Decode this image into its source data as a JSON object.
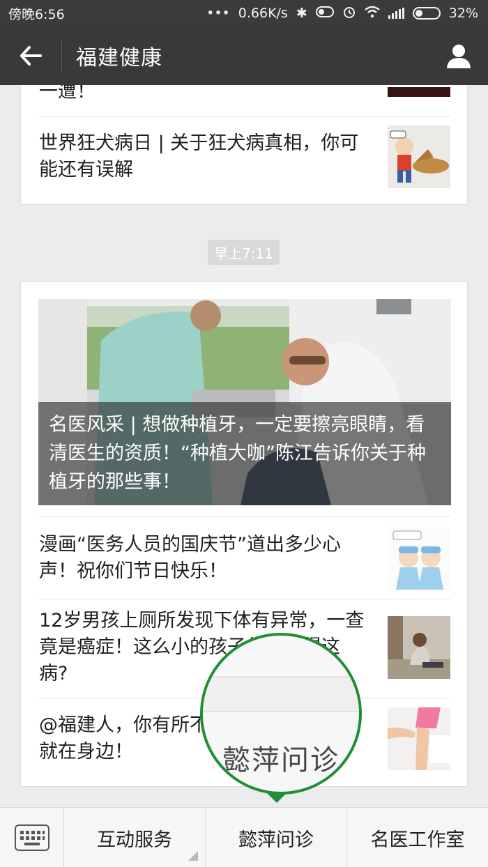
{
  "status_bar": {
    "time": "傍晚6:56",
    "network_speed": "0.66K/s",
    "battery": "32%"
  },
  "nav": {
    "title": "福建健康"
  },
  "feed": {
    "card_a": {
      "clipped_title": "一遭！",
      "items": [
        {
          "title": "世界狂犬病日 | 关于狂犬病真相，你可能还有误解"
        }
      ]
    },
    "timestamp": "早上7:11",
    "card_b": {
      "hero_title": "名医风采 | 想做种植牙，一定要擦亮眼睛，看清医生的资质！“种植大咖”陈江告诉你关于种植牙的那些事！",
      "items": [
        {
          "title": "漫画“医务人员的国庆节”道出多少心声！祝你们节日快乐！"
        },
        {
          "title": "12岁男孩上厕所发现下体有异常，一查竟是癌症！这么小的孩子怎么会得这病?"
        },
        {
          "title": "@福建人，你有所不知，这些便民服务就在身边！"
        }
      ]
    }
  },
  "magnifier": {
    "label": "懿萍问诊"
  },
  "bottom_menu": {
    "items": [
      "互动服务",
      "懿萍问诊",
      "名医工作室"
    ]
  },
  "colors": {
    "header_bg": "#39393b",
    "accent_green": "#1e8f35"
  }
}
